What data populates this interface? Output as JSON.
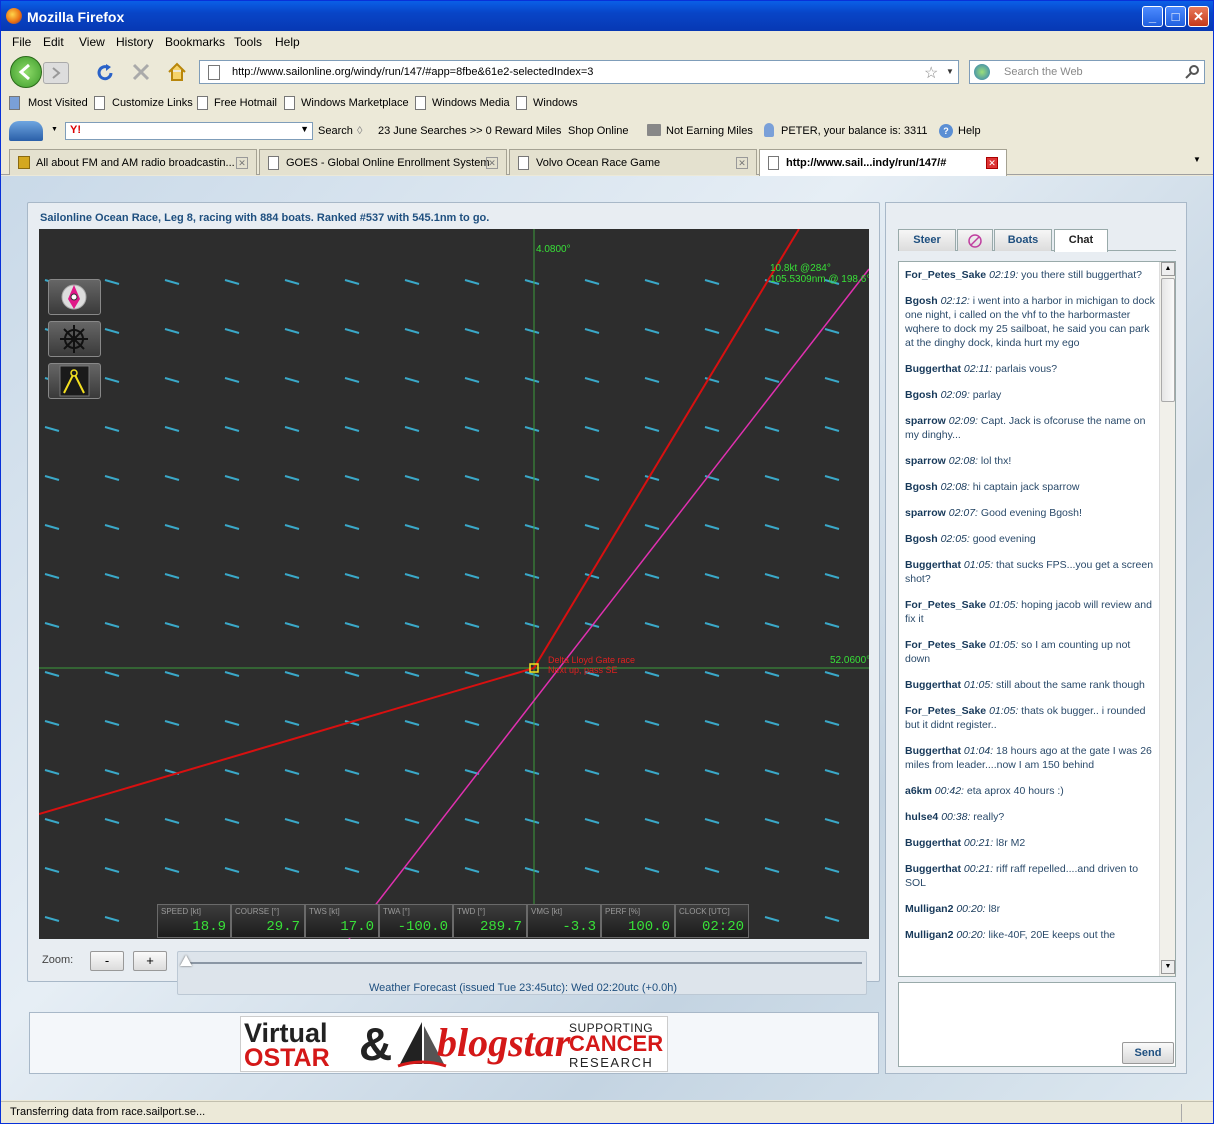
{
  "window": {
    "title": "Mozilla Firefox"
  },
  "menu": [
    "File",
    "Edit",
    "View",
    "History",
    "Bookmarks",
    "Tools",
    "Help"
  ],
  "nav": {
    "url": "http://www.sailonline.org/windy/run/147/#app=8fbe&61e2-selectedIndex=3",
    "search_placeholder": "Search the Web"
  },
  "bookmarks": [
    "Most Visited",
    "Customize Links",
    "Free Hotmail",
    "Windows Marketplace",
    "Windows Media",
    "Windows"
  ],
  "toolbar": {
    "search": "Search",
    "searches": "23 June Searches >> 0 Reward Miles",
    "shop": "Shop Online",
    "earning": "Not Earning Miles",
    "balance": "PETER, your balance is:  3311",
    "help": "Help"
  },
  "tabs": [
    {
      "label": "All about FM and AM radio broadcastin..."
    },
    {
      "label": "GOES - Global Online Enrollment System"
    },
    {
      "label": "Volvo Ocean Race Game"
    },
    {
      "label": "http://www.sail...indy/run/147/#"
    }
  ],
  "race": {
    "title": "Sailonline Ocean Race, Leg 8, racing with 884 boats. Ranked #537 with 545.1nm to go.",
    "lon_label": "4.0800°",
    "lat_label": "52.0600°",
    "wind_label_1": "10.8kt @284°",
    "wind_label_2": "105.5309nm @ 198.6°",
    "mark_label_1": "Delta Lloyd Gate race",
    "mark_label_2": "Next up, pass SE"
  },
  "instruments": [
    {
      "label": "SPEED [kt]",
      "value": "18.9"
    },
    {
      "label": "COURSE [°]",
      "value": "29.7"
    },
    {
      "label": "TWS [kt]",
      "value": "17.0"
    },
    {
      "label": "TWA [°]",
      "value": "-100.0"
    },
    {
      "label": "TWD [°]",
      "value": "289.7"
    },
    {
      "label": "VMG [kt]",
      "value": "-3.3"
    },
    {
      "label": "PERF [%]",
      "value": "100.0"
    },
    {
      "label": "CLOCK [UTC]",
      "value": "02:20"
    }
  ],
  "zoom": {
    "label": "Zoom:",
    "minus": "-",
    "plus": "+",
    "forecast": "Weather Forecast  (issued Tue 23:45utc): Wed 02:20utc  (+0.0h)"
  },
  "banner": {
    "virtual": "Virtual",
    "ostar": "OSTAR",
    "amp": "&",
    "blogstar": "blogstar",
    "supporting": "SUPPORTING",
    "cancer": "CANCER",
    "research": "RESEARCH"
  },
  "panel_tabs": {
    "steer": "Steer",
    "boats": "Boats",
    "chat": "Chat"
  },
  "chat": [
    {
      "user": "For_Petes_Sake",
      "time": "02:19:",
      "text": " you there still buggerthat?"
    },
    {
      "user": "Bgosh",
      "time": "02:12:",
      "text": " i  went into a harbor in michigan to dock one night,  i called on the vhf to the harbormaster wqhere to dock my 25 sailboat,  he said you can park at the dinghy dock, kinda hurt my ego"
    },
    {
      "user": "Buggerthat",
      "time": "02:11:",
      "text": " parlais vous?"
    },
    {
      "user": "Bgosh",
      "time": "02:09:",
      "text": " parlay"
    },
    {
      "user": "sparrow",
      "time": "02:09:",
      "text": " Capt. Jack is ofcoruse the name on my dinghy..."
    },
    {
      "user": "sparrow",
      "time": "02:08:",
      "text": " lol thx!"
    },
    {
      "user": "Bgosh",
      "time": "02:08:",
      "text": " hi captain jack sparrow"
    },
    {
      "user": "sparrow",
      "time": "02:07:",
      "text": " Good evening Bgosh!"
    },
    {
      "user": "Bgosh",
      "time": "02:05:",
      "text": " good evening"
    },
    {
      "user": "Buggerthat",
      "time": "01:05:",
      "text": " that sucks FPS...you get a screen shot?"
    },
    {
      "user": "For_Petes_Sake",
      "time": "01:05:",
      "text": " hoping jacob will review and fix it"
    },
    {
      "user": "For_Petes_Sake",
      "time": "01:05:",
      "text": " so I am counting up not down"
    },
    {
      "user": "Buggerthat",
      "time": "01:05:",
      "text": " still about the same rank though"
    },
    {
      "user": "For_Petes_Sake",
      "time": "01:05:",
      "text": " thats ok bugger.. i rounded but it didnt register.."
    },
    {
      "user": "Buggerthat",
      "time": "01:04:",
      "text": " 18 hours ago at the gate I was 26 miles from leader....now I am 150 behind"
    },
    {
      "user": "a6km",
      "time": "00:42:",
      "text": " eta aprox 40 hours :)"
    },
    {
      "user": "hulse4",
      "time": "00:38:",
      "text": " really?"
    },
    {
      "user": "Buggerthat",
      "time": "00:21:",
      "text": " l8r M2"
    },
    {
      "user": "Buggerthat",
      "time": "00:21:",
      "text": " riff raff repelled....and driven to SOL"
    },
    {
      "user": "Mulligan2",
      "time": "00:20:",
      "text": " l8r"
    },
    {
      "user": "Mulligan2",
      "time": "00:20:",
      "text": " like-40F, 20E keeps out the"
    }
  ],
  "send": "Send",
  "status": "Transferring data from race.sailport.se..."
}
